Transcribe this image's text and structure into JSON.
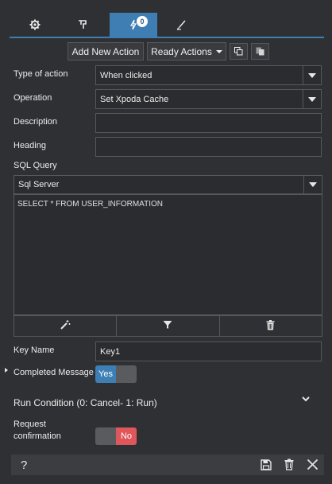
{
  "tabs": [
    {
      "icon": "gear-icon"
    },
    {
      "icon": "flag-icon"
    },
    {
      "icon": "lightning-icon",
      "badge": "0"
    },
    {
      "icon": "brush-icon"
    }
  ],
  "toolbar": {
    "add_new_action": "Add New Action",
    "ready_actions": "Ready Actions",
    "copy_icon": "copy-icon",
    "paste_icon": "paste-icon"
  },
  "form": {
    "type_of_action_label": "Type of action",
    "type_of_action_value": "When clicked",
    "operation_label": "Operation",
    "operation_value": "Set Xpoda Cache",
    "description_label": "Description",
    "description_value": "",
    "heading_label": "Heading",
    "heading_value": "",
    "sql_query_label": "SQL Query",
    "sql_engine_value": "Sql Server",
    "sql_text": "SELECT * FROM USER_INFORMATION",
    "key_name_label": "Key Name",
    "key_name_value": "Key1",
    "completed_message_label": "Completed Message",
    "completed_message_toggle": "Yes",
    "run_condition_label": "Run Condition (0: Cancel- 1: Run)",
    "request_confirmation_label_1": "Request",
    "request_confirmation_label_2": "confirmation",
    "request_confirmation_toggle": "No"
  },
  "footer": {
    "help": "?"
  },
  "colors": {
    "accent": "#3f7eb3",
    "background": "#2f3033",
    "no_red": "#e0575b",
    "yes_blue": "#3d7fb5"
  }
}
